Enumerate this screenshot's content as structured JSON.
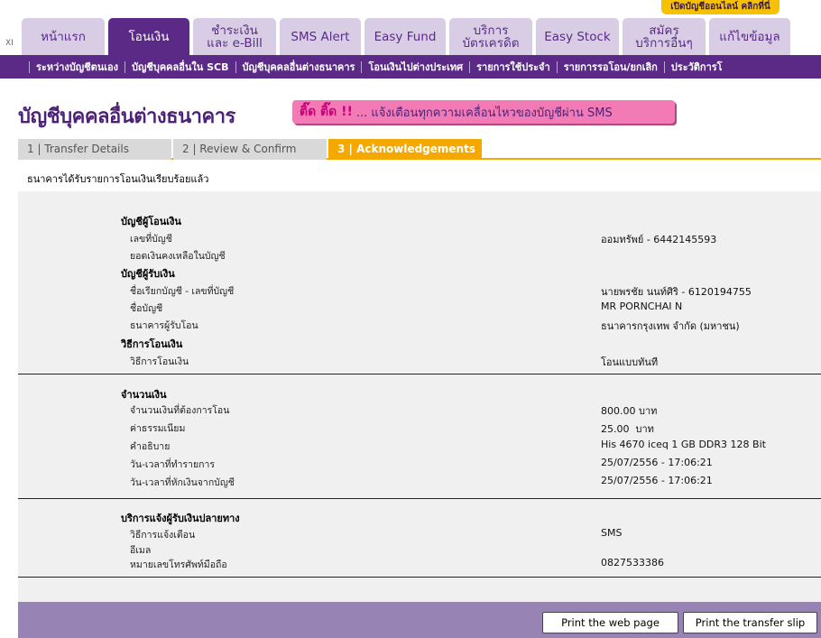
{
  "promo": "เปิดบัญชีออนไลน์ คลิกที่นี่",
  "xi": "XI",
  "tabs": [
    {
      "label": "หน้าแรก",
      "label2": ""
    },
    {
      "label": "โอนเงิน",
      "label2": ""
    },
    {
      "label": "ชำระเงิน",
      "label2": "และ e-Bill"
    },
    {
      "label": "SMS Alert",
      "label2": ""
    },
    {
      "label": "Easy Fund",
      "label2": ""
    },
    {
      "label": "บริการ",
      "label2": "บัตรเครดิต"
    },
    {
      "label": "Easy Stock",
      "label2": ""
    },
    {
      "label": "สมัคร",
      "label2": "บริการอื่นๆ"
    },
    {
      "label": "แก้ไขข้อมูล",
      "label2": ""
    }
  ],
  "subnav": [
    "ระหว่างบัญชีตนเอง",
    "บัญชีบุคคลอื่นใน SCB",
    "บัญชีบุคคลอื่นต่างธนาคาร",
    "โอนเงินไปต่างประเทศ",
    "รายการใช้ประจำ",
    "รายการรอโอน/ยกเลิก",
    "ประวัติการโ"
  ],
  "page_title": "บัญชีบุคคลอื่นต่างธนาคาร",
  "banner": {
    "prefix": "ติ๊ด ติ๊ด !!",
    "text": "... แจ้งเตือนทุกความเคลื่อนไหวของบัญชีผ่าน SMS"
  },
  "steps": [
    "1 | Transfer Details",
    "2 | Review & Confirm",
    "3 | Acknowledgements"
  ],
  "notice": "ธนาคารได้รับรายการโอนเงินเรียบร้อยแล้ว",
  "from": {
    "heading": "บัญชีผู้โอนเงิน",
    "account_label": "เลขที่บัญชี",
    "account_value": "ออมทรัพย์ - 6442145593",
    "balance_label": "ยอดเงินคงเหลือในบัญชี",
    "balance_value": ""
  },
  "to": {
    "heading": "บัญชีผู้รับเงิน",
    "nick_label": "ชื่อเรียกบัญชี - เลขที่บัญชี",
    "nick_value": "นายพรชัย นนท์ศิริ - 6120194755",
    "name_label": "ชื่อบัญชี",
    "name_value": "MR PORNCHAI N",
    "bank_label": "ธนาคารผู้รับโอน",
    "bank_value": "ธนาคารกรุงเทพ จำกัด (มหาชน)"
  },
  "method": {
    "heading": "วิธีการโอนเงิน",
    "label": "วิธีการโอนเงิน",
    "value": "โอนแบบทันที"
  },
  "amount": {
    "heading": "จำนวนเงิน",
    "amount_label": "จำนวนเงินที่ต้องการโอน",
    "amount_value": "800.00 บาท",
    "fee_label": "ค่าธรรมเนียม",
    "fee_value": "25.00  บาท",
    "desc_label": "คำอธิบาย",
    "desc_value": "His 4670 iceq 1 GB DDR3 128 Bit",
    "txn_time_label": "วัน-เวลาที่ทำรายการ",
    "txn_time_value": "25/07/2556 - 17:06:21",
    "debit_time_label": "วัน-เวลาที่หักเงินจากบัญชี",
    "debit_time_value": "25/07/2556 - 17:06:21"
  },
  "notify": {
    "heading": "บริการแจ้งผู้รับเงินปลายทาง",
    "method_label": "วิธีการแจ้งเตือน",
    "method_value": "SMS",
    "email_label": "อีเมล",
    "email_value": "",
    "phone_label": "หมายเลขโทรศัพท์มือถือ",
    "phone_value": "0827533386"
  },
  "buttons": {
    "print_page": "Print the web page",
    "print_slip": "Print the transfer slip"
  }
}
